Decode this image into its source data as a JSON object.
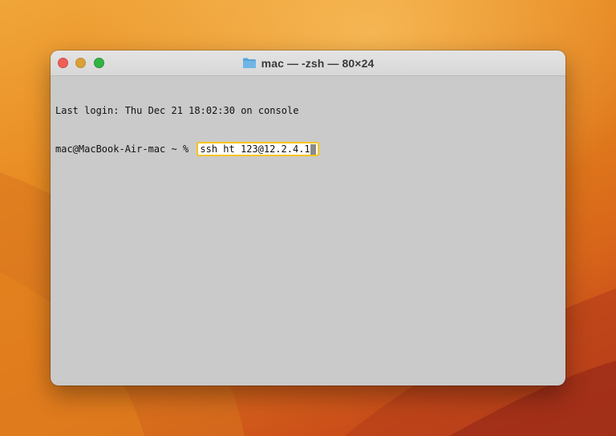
{
  "window": {
    "title": "mac — -zsh — 80×24"
  },
  "terminal": {
    "last_login": "Last login: Thu Dec 21 18:02:30 on console",
    "prompt": "mac@MacBook-Air-mac ~ % ",
    "command": "ssh ht 123@12.2.4.1"
  },
  "colors": {
    "highlight_border": "#f5c518",
    "traffic_red": "#ed5f57",
    "traffic_yellow": "#d9a13a",
    "traffic_green": "#33b344"
  },
  "icons": {
    "title_icon": "folder-icon"
  }
}
